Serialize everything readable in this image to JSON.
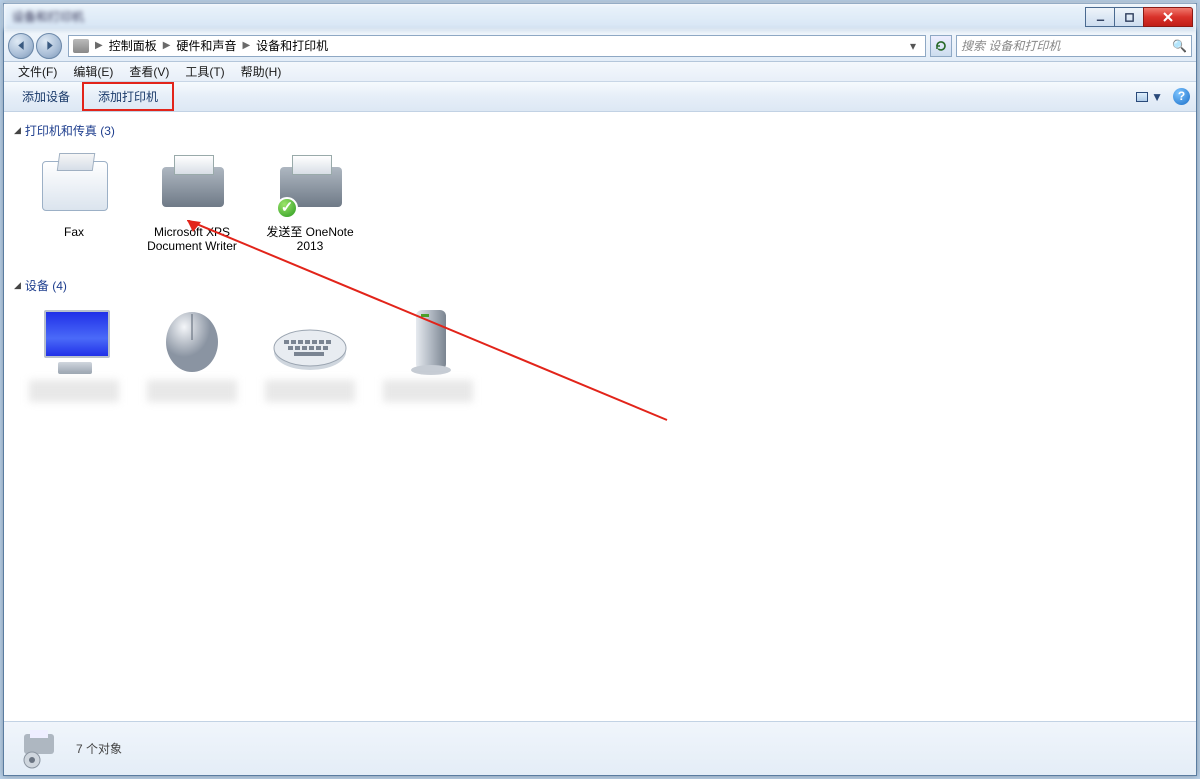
{
  "titlebar": {
    "text": "设备和打印机"
  },
  "window_controls": {
    "min": "minimize",
    "max": "maximize",
    "close": "close"
  },
  "breadcrumbs": [
    "控制面板",
    "硬件和声音",
    "设备和打印机"
  ],
  "search": {
    "placeholder": "搜索 设备和打印机"
  },
  "menubar": [
    "文件(F)",
    "编辑(E)",
    "查看(V)",
    "工具(T)",
    "帮助(H)"
  ],
  "toolbar": {
    "add_device": "添加设备",
    "add_printer": "添加打印机"
  },
  "sections": {
    "printers": {
      "title": "打印机和传真 (3)"
    },
    "devices": {
      "title": "设备 (4)"
    }
  },
  "printers": [
    {
      "name": "Fax"
    },
    {
      "name": "Microsoft XPS Document Writer"
    },
    {
      "name": "发送至 OneNote 2013"
    }
  ],
  "devices_count": 4,
  "statusbar": {
    "text": "7 个对象"
  }
}
